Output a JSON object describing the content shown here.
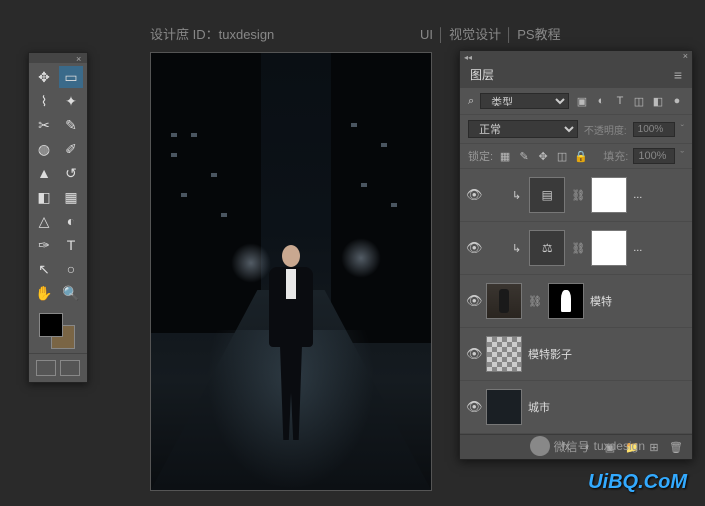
{
  "header": {
    "author_prefix": "设计庶 ID：",
    "author_id": "tuxdesign",
    "nav_ui": "UI",
    "nav_visual": "视觉设计",
    "nav_tutorial": "PS教程"
  },
  "toolbar": {
    "tools": [
      {
        "name": "move",
        "glyph": "✥"
      },
      {
        "name": "marquee",
        "glyph": "▭"
      },
      {
        "name": "lasso",
        "glyph": "⌇"
      },
      {
        "name": "quick-select",
        "glyph": "✦"
      },
      {
        "name": "crop",
        "glyph": "✂"
      },
      {
        "name": "eyedropper",
        "glyph": "✎"
      },
      {
        "name": "healing",
        "glyph": "◍"
      },
      {
        "name": "brush",
        "glyph": "✐"
      },
      {
        "name": "stamp",
        "glyph": "▲"
      },
      {
        "name": "history-brush",
        "glyph": "↺"
      },
      {
        "name": "eraser",
        "glyph": "◧"
      },
      {
        "name": "gradient",
        "glyph": "▦"
      },
      {
        "name": "blur",
        "glyph": "△"
      },
      {
        "name": "dodge",
        "glyph": "◐"
      },
      {
        "name": "pen",
        "glyph": "✑"
      },
      {
        "name": "type",
        "glyph": "T"
      },
      {
        "name": "path-select",
        "glyph": "↖"
      },
      {
        "name": "shape",
        "glyph": "○"
      },
      {
        "name": "hand",
        "glyph": "✋"
      },
      {
        "name": "zoom",
        "glyph": "🔍"
      }
    ],
    "fg_color": "#000000",
    "bg_color": "#7a6545"
  },
  "layers_panel": {
    "title": "图层",
    "filter_label": "类型",
    "search_icon": "⌕",
    "filter_icons": [
      "▣",
      "◐",
      "T",
      "◫",
      "◧",
      "●"
    ],
    "blend_mode": "正常",
    "opacity_label": "不透明度:",
    "opacity_value": "100%",
    "lock_label": "锁定:",
    "lock_icons": [
      "▦",
      "✎",
      "✥",
      "◫",
      "🔒"
    ],
    "fill_label": "填充:",
    "fill_value": "100%",
    "layers": [
      {
        "visible": true,
        "clipped": true,
        "type": "adjustment",
        "adj_icon": "▤",
        "mask": true,
        "name": "..."
      },
      {
        "visible": true,
        "clipped": true,
        "type": "adjustment",
        "adj_icon": "⚖",
        "mask": true,
        "name": "..."
      },
      {
        "visible": true,
        "clipped": false,
        "type": "image-model",
        "mask": "person",
        "name": "模特"
      },
      {
        "visible": true,
        "clipped": false,
        "type": "checker",
        "mask": false,
        "name": "模特影子"
      },
      {
        "visible": true,
        "clipped": false,
        "type": "city",
        "mask": false,
        "name": "城市"
      }
    ],
    "footer_icons": [
      "⬔",
      "fx",
      "◐",
      "▣",
      "📁",
      "⊞",
      "🗑"
    ]
  },
  "watermark": {
    "wechat_label": "微信号",
    "wechat_id": "tuxdesign",
    "site": "UiBQ.CoM"
  }
}
